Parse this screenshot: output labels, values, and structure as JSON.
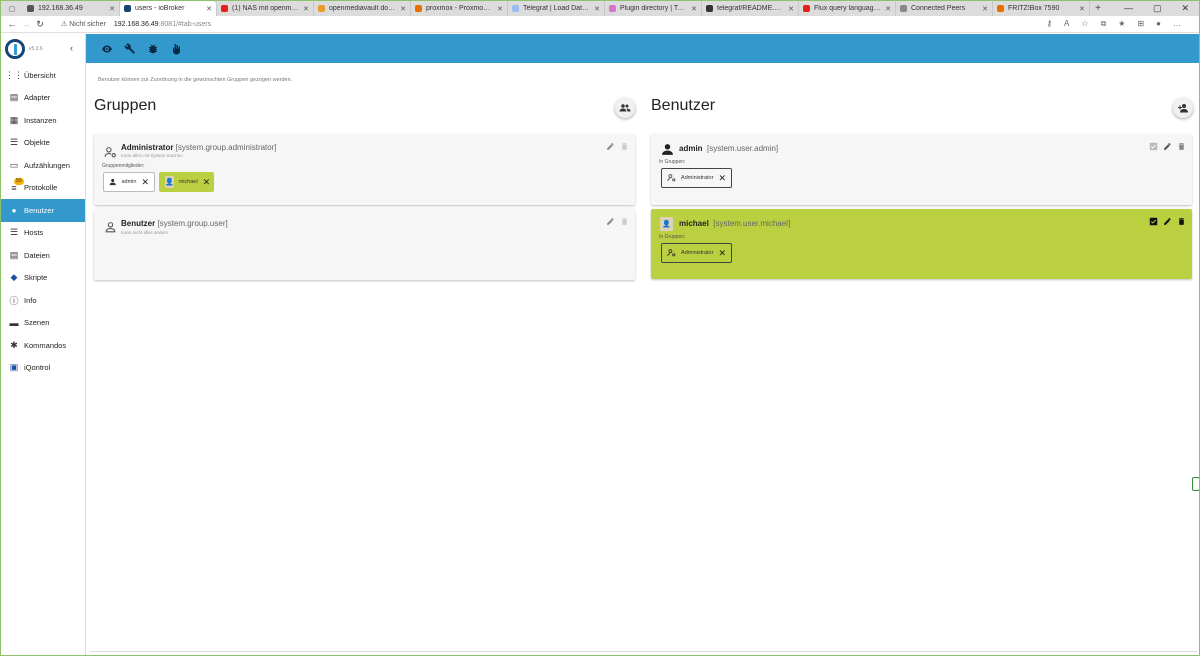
{
  "browser": {
    "tabs": [
      {
        "title": "192.168.36.49",
        "favicon_color": "#555555",
        "active": false
      },
      {
        "title": "users - ioBroker",
        "favicon_color": "#164477",
        "active": true
      },
      {
        "title": "(1) NAS mit openmediava…",
        "favicon_color": "#e62117",
        "active": false
      },
      {
        "title": "openmediavault downloa…",
        "favicon_color": "#e89c2d",
        "active": false
      },
      {
        "title": "proxmox - Proxmox Virtu…",
        "favicon_color": "#e57000",
        "active": false
      },
      {
        "title": "Telegraf | Load Data | Idb…",
        "favicon_color": "#9bbcf0",
        "active": false
      },
      {
        "title": "Plugin directory | Telegra…",
        "favicon_color": "#d675c9",
        "active": false
      },
      {
        "title": "telegraf/README.md at m…",
        "favicon_color": "#333333",
        "active": false
      },
      {
        "title": "Flux query language and …",
        "favicon_color": "#e62117",
        "active": false
      },
      {
        "title": "Connected Peers",
        "favicon_color": "#888888",
        "active": false
      },
      {
        "title": "FRITZ!Box 7590",
        "favicon_color": "#e57000",
        "active": false
      }
    ],
    "security": "Nicht sicher",
    "url_host": "192.168.36.49",
    "url_rest": ":8081/#tab-users"
  },
  "app": {
    "version": "v5.3.6",
    "accent": "#3399cc",
    "highlight": "#bbd040"
  },
  "sidebar": {
    "items": [
      {
        "label": "Übersicht",
        "icon": "apps-icon"
      },
      {
        "label": "Adapter",
        "icon": "store-icon"
      },
      {
        "label": "Instanzen",
        "icon": "instances-icon"
      },
      {
        "label": "Objekte",
        "icon": "list-icon"
      },
      {
        "label": "Aufzählungen",
        "icon": "enums-icon"
      },
      {
        "label": "Protokolle",
        "icon": "log-icon",
        "badge": "50"
      },
      {
        "label": "Benutzer",
        "icon": "person-icon",
        "active": true
      },
      {
        "label": "Hosts",
        "icon": "hosts-icon"
      },
      {
        "label": "Dateien",
        "icon": "files-icon"
      },
      {
        "label": "Skripte",
        "icon": "script-icon"
      },
      {
        "label": "Info",
        "icon": "info-icon"
      },
      {
        "label": "Szenen",
        "icon": "scenes-icon"
      },
      {
        "label": "Kommandos",
        "icon": "commands-icon"
      },
      {
        "label": "iQontrol",
        "icon": "iqontrol-icon"
      }
    ]
  },
  "main": {
    "hint": "Benutzer können zur Zuordnung in die gewünschten Gruppen gezogen werden.",
    "groups_title": "Gruppen",
    "users_title": "Benutzer",
    "groups": [
      {
        "name": "Administrator",
        "id": "[system.group.administrator]",
        "desc": "Kann alles mit System machen",
        "members_label": "Gruppenmitglieder:",
        "members": [
          "admin",
          "michael"
        ]
      },
      {
        "name": "Benutzer",
        "id": "[system.group.user]",
        "desc": "Kann nicht alles ändern"
      }
    ],
    "users": [
      {
        "name": "admin",
        "id": "[system.user.admin]",
        "groups_label": "In Gruppen:",
        "groups": [
          "Administrator"
        ]
      },
      {
        "name": "michael",
        "id": "[system.user.michael]",
        "groups_label": "In Gruppen:",
        "groups": [
          "Administrator"
        ]
      }
    ]
  }
}
